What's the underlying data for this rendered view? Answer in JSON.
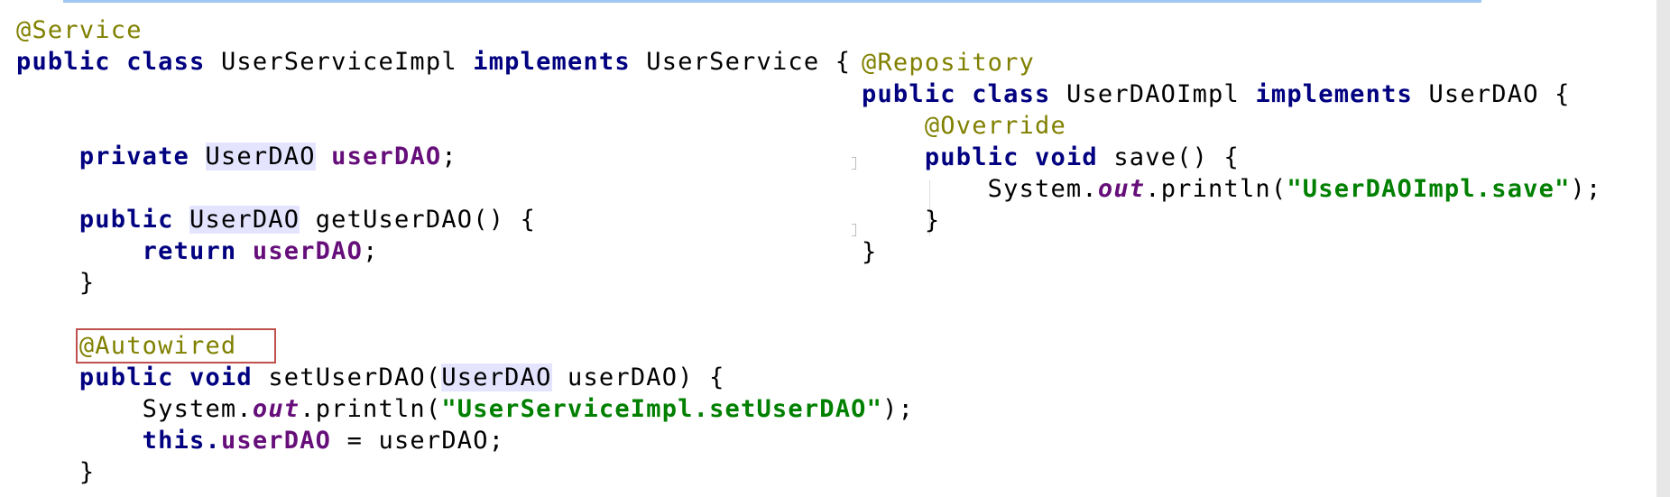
{
  "service_class": {
    "annotation": "@Service",
    "kw_public": "public",
    "kw_class": "class",
    "class_name": "UserServiceImpl",
    "kw_implements": "implements",
    "interface_name": "UserService",
    "open_brace": "{",
    "field_line": {
      "kw_private": "private",
      "type": "UserDAO",
      "name": "userDAO",
      "end": ";"
    },
    "getter": {
      "kw_public": "public",
      "return_type": "UserDAO",
      "signature": "getUserDAO() {",
      "kw_return": "return",
      "field": "userDAO",
      "end": ";",
      "close_brace": "}"
    },
    "setter": {
      "annotation": "@Autowired",
      "kw_public": "public",
      "kw_void": "void",
      "name_open": "setUserDAO(",
      "param_type": "UserDAO",
      "param_rest": " userDAO) {",
      "println_prefix": "System.",
      "println_static": "out",
      "println_call": ".println(",
      "println_string": "\"UserServiceImpl.setUserDAO\"",
      "println_end": ");",
      "kw_this": "this.",
      "field": "userDAO",
      "assign_rest": " = userDAO;",
      "close_brace": "}"
    }
  },
  "repository_class": {
    "annotation": "@Repository",
    "kw_public": "public",
    "kw_class": "class",
    "class_name": "UserDAOImpl",
    "kw_implements": "implements",
    "interface_name": "UserDAO",
    "open_brace": "{",
    "method": {
      "annotation": "@Override",
      "kw_public": "public",
      "kw_void": "void",
      "signature": "save() {",
      "println_prefix": "System.",
      "println_static": "out",
      "println_call": ".println(",
      "println_string": "\"UserDAOImpl.save\"",
      "println_end": ");",
      "close_brace": "}"
    },
    "close_brace": "}"
  },
  "colors": {
    "keyword": "#000080",
    "annotation": "#808000",
    "field": "#660e7a",
    "string": "#008000",
    "usage_highlight": "#e4e4ff",
    "annotation_box": "#c0504d",
    "top_rule": "#9ec8f2"
  }
}
